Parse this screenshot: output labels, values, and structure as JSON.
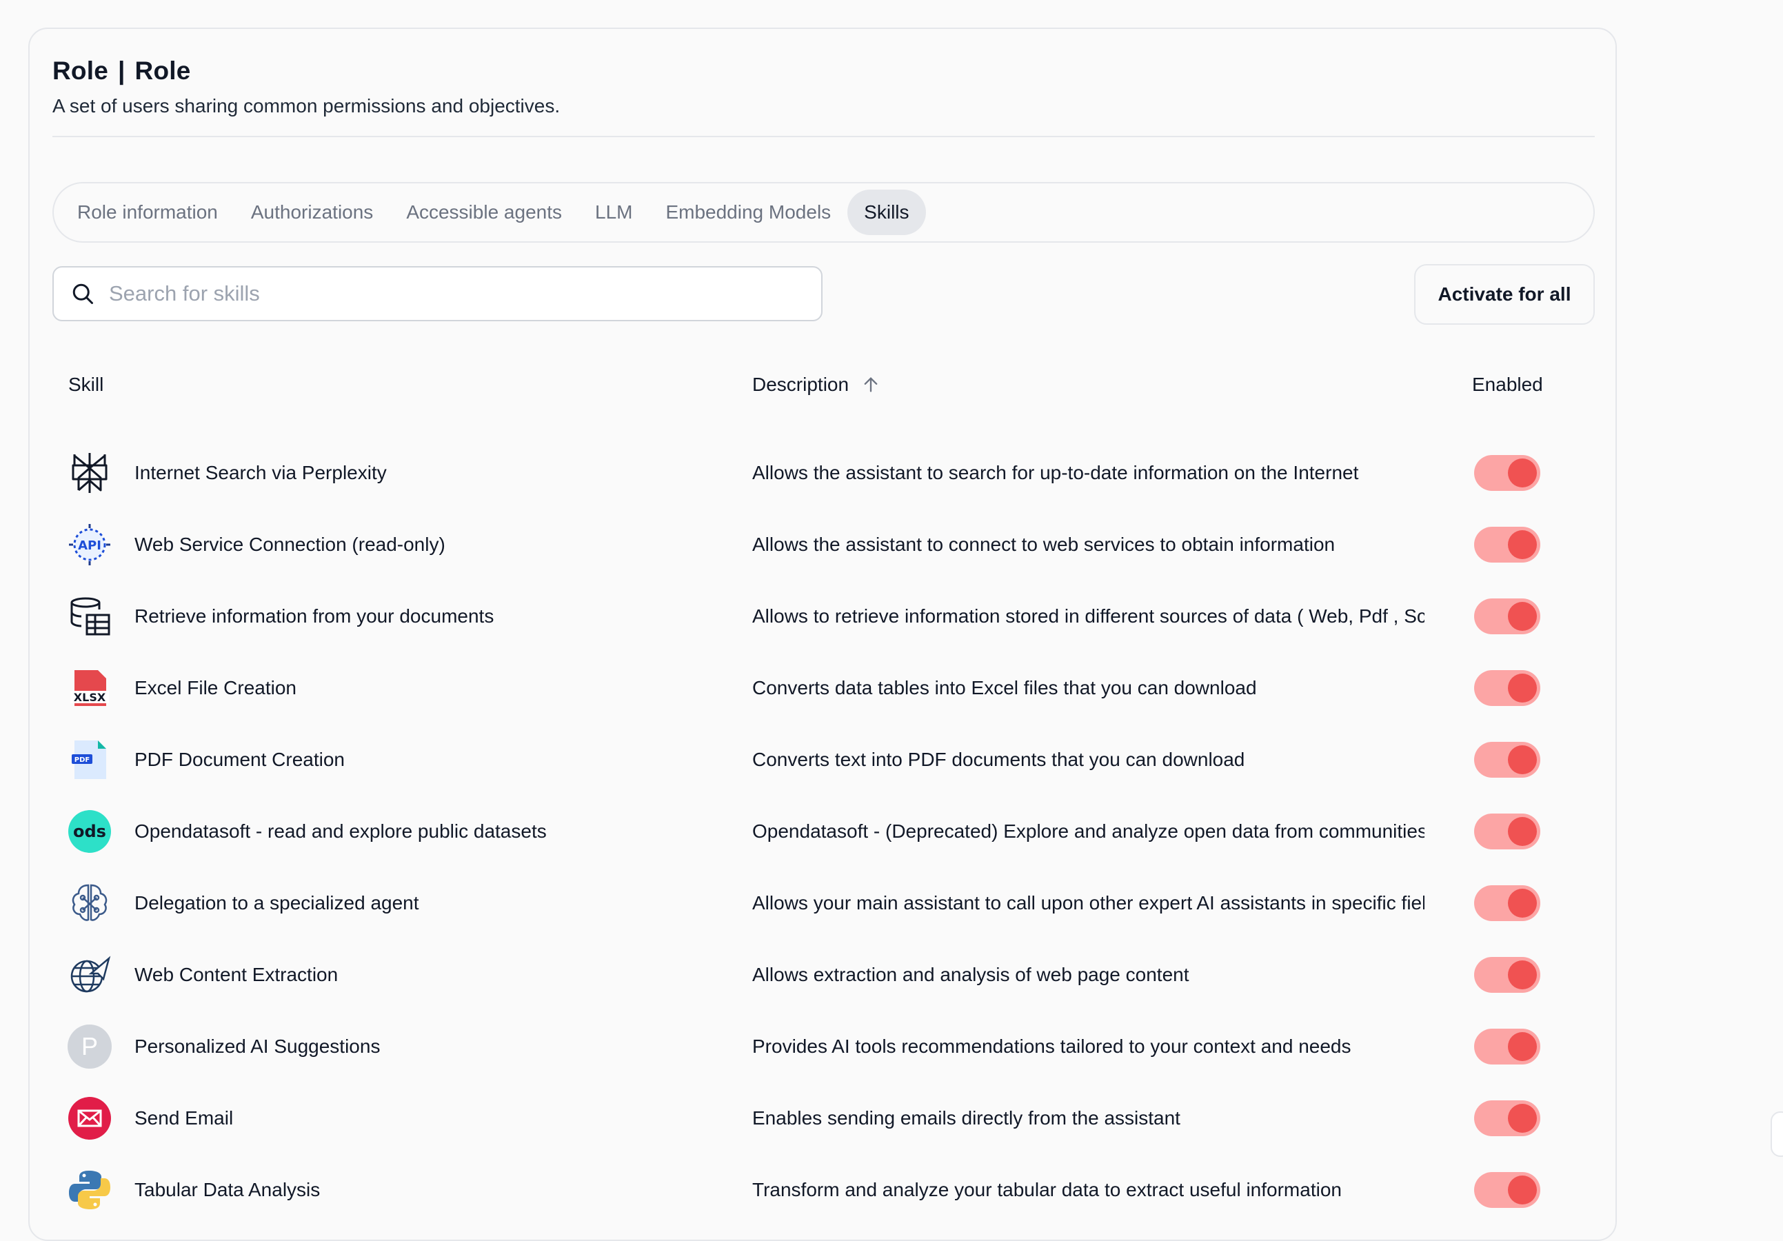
{
  "header": {
    "title_left": "Role",
    "title_sep": "|",
    "title_right": "Role",
    "subtitle": "A set of users sharing common permissions and objectives."
  },
  "tabs": [
    {
      "label": "Role information",
      "active": false
    },
    {
      "label": "Authorizations",
      "active": false
    },
    {
      "label": "Accessible agents",
      "active": false
    },
    {
      "label": "LLM",
      "active": false
    },
    {
      "label": "Embedding Models",
      "active": false
    },
    {
      "label": "Skills",
      "active": true
    }
  ],
  "search": {
    "placeholder": "Search for skills",
    "value": ""
  },
  "activate_all_label": "Activate for all",
  "table": {
    "col_skill": "Skill",
    "col_description": "Description",
    "col_enabled": "Enabled",
    "sort": "ascending",
    "rows": [
      {
        "icon": "perplexity-icon",
        "name": "Internet Search via Perplexity",
        "description": "Allows the assistant to search for up-to-date information on the Internet",
        "enabled": true
      },
      {
        "icon": "api-icon",
        "name": "Web Service Connection (read-only)",
        "description": "Allows the assistant to connect to web services to obtain information",
        "enabled": true
      },
      {
        "icon": "database-icon",
        "name": "Retrieve information from your documents",
        "description": "Allows to retrieve information stored in different sources of data ( Web, Pdf , Sc",
        "enabled": true
      },
      {
        "icon": "xlsx-file-icon",
        "name": "Excel File Creation",
        "description": "Converts data tables into Excel files that you can download",
        "enabled": true
      },
      {
        "icon": "pdf-file-icon",
        "name": "PDF Document Creation",
        "description": "Converts text into PDF documents that you can download",
        "enabled": true
      },
      {
        "icon": "ods-logo-icon",
        "name": "Opendatasoft - read and explore public datasets",
        "description": "Opendatasoft - (Deprecated) Explore and analyze open data from communities",
        "enabled": true
      },
      {
        "icon": "brain-network-icon",
        "name": "Delegation to a specialized agent",
        "description": "Allows your main assistant to call upon other expert AI assistants in specific fiel",
        "enabled": true
      },
      {
        "icon": "globe-send-icon",
        "name": "Web Content Extraction",
        "description": "Allows extraction and analysis of web page content",
        "enabled": true
      },
      {
        "icon": "letter-p-avatar-icon",
        "letter": "P",
        "name": "Personalized AI Suggestions",
        "description": "Provides AI tools recommendations tailored to your context and needs",
        "enabled": true
      },
      {
        "icon": "email-icon",
        "name": "Send Email",
        "description": "Enables sending emails directly from the assistant",
        "enabled": true
      },
      {
        "icon": "python-icon",
        "name": "Tabular Data Analysis",
        "description": "Transform and analyze your tabular data to extract useful information",
        "enabled": true
      }
    ]
  },
  "colors": {
    "toggle_track": "#fca5a5",
    "toggle_knob": "#f05252",
    "active_tab_bg": "#e5e7eb"
  }
}
